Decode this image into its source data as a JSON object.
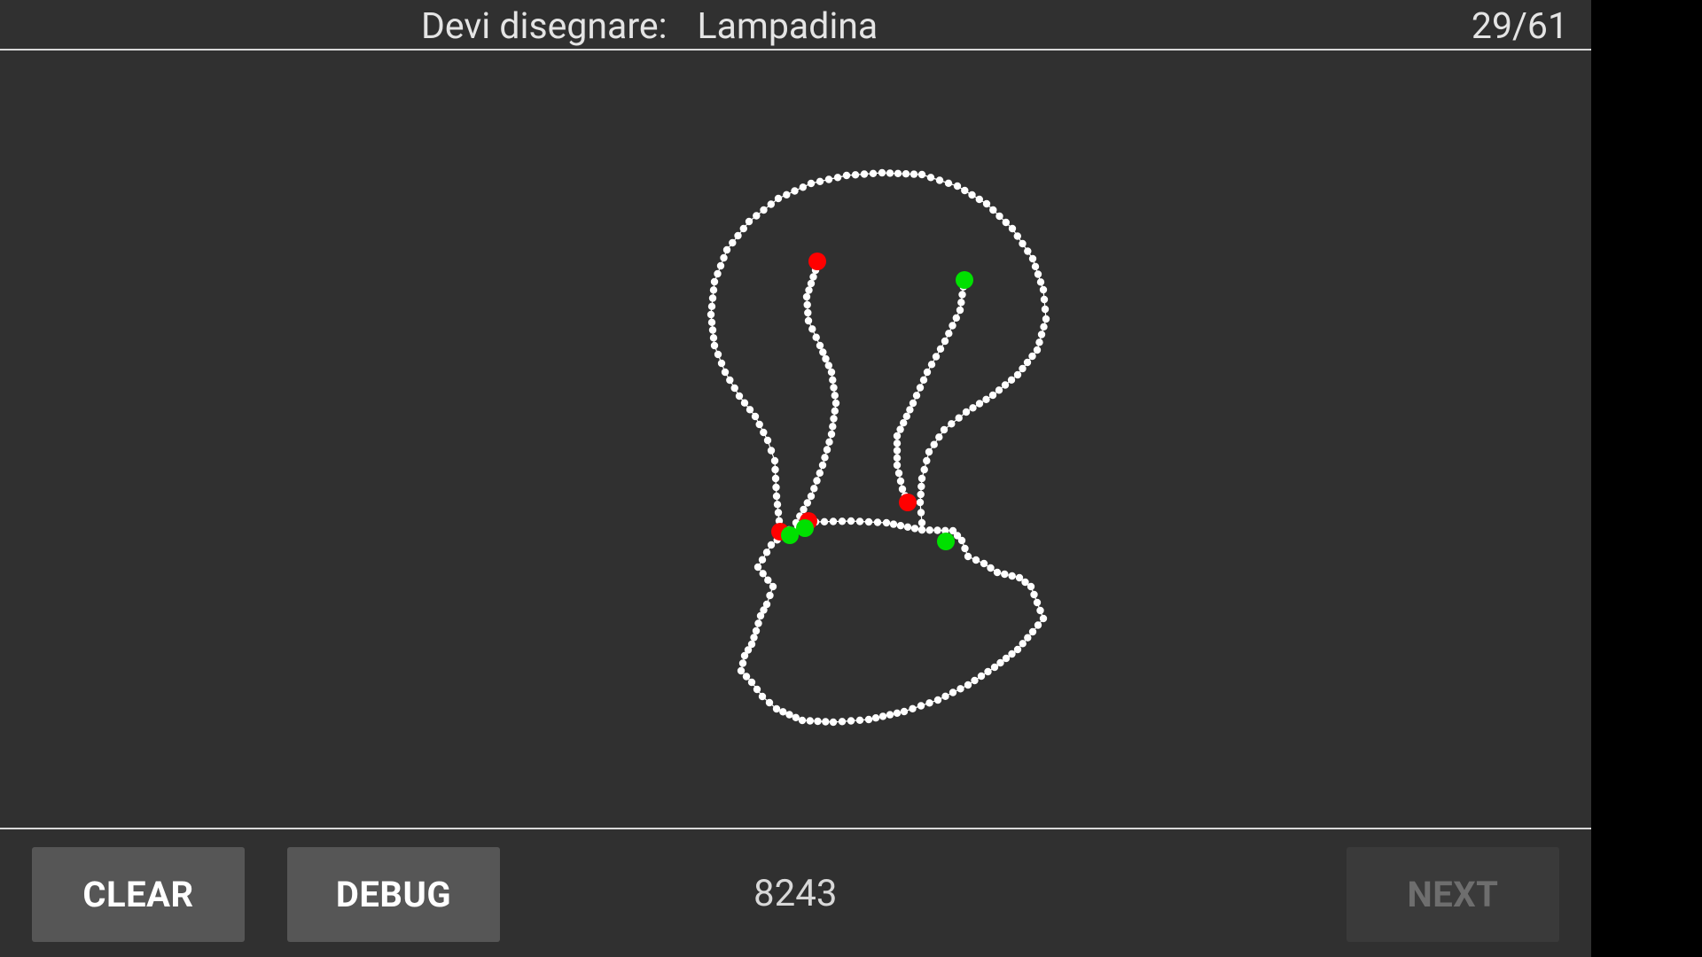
{
  "header": {
    "prompt_label": "Devi disegnare:",
    "target_word": "Lampadina",
    "progress": "29/61"
  },
  "toolbar": {
    "clear_label": "CLEAR",
    "debug_label": "DEBUG",
    "score": "8243",
    "next_label": "NEXT",
    "next_enabled": false
  },
  "drawing": {
    "subject": "lightbulb",
    "stroke_color": "#ffffff",
    "start_marker_color": "#00e000",
    "end_marker_color": "#ff0000",
    "stroke_count": 4
  },
  "colors": {
    "background": "#303030",
    "divider": "#d8d8d8",
    "button": "#565656",
    "button_disabled": "#3a3a3a",
    "text": "#e4e4e4"
  }
}
